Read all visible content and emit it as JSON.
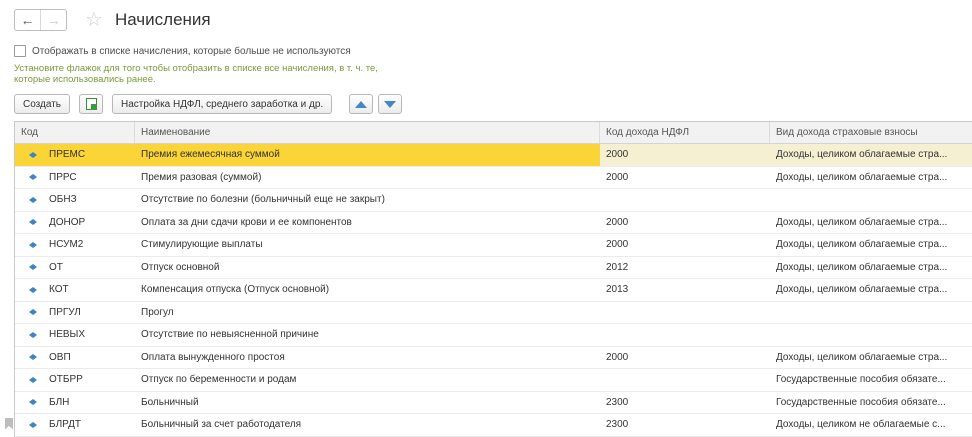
{
  "header": {
    "title": "Начисления",
    "back_icon": "←",
    "forward_icon": "→",
    "star_icon": "☆"
  },
  "filter": {
    "checkbox_label": "Отображать в списке начисления, которые больше не используются",
    "checked": false,
    "hint": "Установите флажок для того чтобы отобразить в списке все начисления, в т. ч. те, которые использовались ранее."
  },
  "toolbar": {
    "create_label": "Создать",
    "settings_label": "Настройка НДФЛ, среднего заработка и др."
  },
  "table": {
    "columns": [
      "Код",
      "Наименование",
      "Код дохода НДФЛ",
      "Вид дохода страховые взносы"
    ],
    "rows": [
      {
        "code": "ПРЕМС",
        "name": "Премия ежемесячная суммой",
        "ndfl": "2000",
        "kind": "Доходы, целиком облагаемые стра..."
      },
      {
        "code": "ПРРС",
        "name": "Премия разовая (суммой)",
        "ndfl": "2000",
        "kind": "Доходы, целиком облагаемые стра..."
      },
      {
        "code": "ОБНЗ",
        "name": "Отсутствие по болезни (больничный еще не закрыт)",
        "ndfl": "",
        "kind": ""
      },
      {
        "code": "ДОНОР",
        "name": "Оплата за дни сдачи крови и ее компонентов",
        "ndfl": "2000",
        "kind": "Доходы, целиком облагаемые стра..."
      },
      {
        "code": "НСУМ2",
        "name": "Стимулирующие выплаты",
        "ndfl": "2000",
        "kind": "Доходы, целиком облагаемые стра..."
      },
      {
        "code": "ОТ",
        "name": "Отпуск основной",
        "ndfl": "2012",
        "kind": "Доходы, целиком облагаемые стра..."
      },
      {
        "code": "КОТ",
        "name": "Компенсация отпуска (Отпуск основной)",
        "ndfl": "2013",
        "kind": "Доходы, целиком облагаемые стра..."
      },
      {
        "code": "ПРГУЛ",
        "name": "Прогул",
        "ndfl": "",
        "kind": ""
      },
      {
        "code": "НЕВЫХ",
        "name": "Отсутствие по невыясненной причине",
        "ndfl": "",
        "kind": ""
      },
      {
        "code": "ОВП",
        "name": "Оплата вынужденного простоя",
        "ndfl": "2000",
        "kind": "Доходы, целиком облагаемые стра..."
      },
      {
        "code": "ОТБРР",
        "name": "Отпуск по беременности и родам",
        "ndfl": "",
        "kind": "Государственные пособия обязате..."
      },
      {
        "code": "БЛН",
        "name": "Больничный",
        "ndfl": "2300",
        "kind": "Государственные пособия обязате..."
      },
      {
        "code": "БЛРДТ",
        "name": "Больничный за счет работодателя",
        "ndfl": "2300",
        "kind": "Доходы, целиком не облагаемые с..."
      }
    ],
    "selected_index": 0
  },
  "colors": {
    "selected_row": "#fbd437",
    "hint_text": "#7a9a3a",
    "arrow_blue": "#3f88c9"
  }
}
